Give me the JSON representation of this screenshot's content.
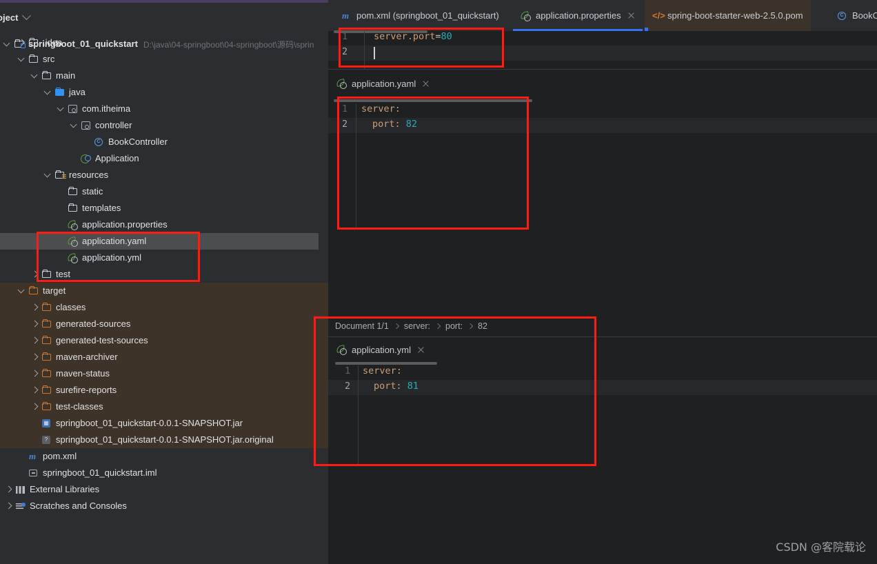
{
  "sidebar": {
    "panel_title": "roject",
    "chevron_icon": "chevron-down-icon",
    "project_name": "springboot_01_quickstart",
    "project_path": "D:\\java\\04-springboot\\04-springboot\\源码\\sprin",
    "items": [
      {
        "label": ".idea",
        "indent": 1,
        "icon": "folder-icon",
        "arrow": "right"
      },
      {
        "label": "src",
        "indent": 1,
        "icon": "folder-icon",
        "arrow": "down"
      },
      {
        "label": "main",
        "indent": 2,
        "icon": "folder-icon",
        "arrow": "down"
      },
      {
        "label": "java",
        "indent": 3,
        "icon": "source-folder-icon",
        "arrow": "down"
      },
      {
        "label": "com.itheima",
        "indent": 4,
        "icon": "package-icon",
        "arrow": "down"
      },
      {
        "label": "controller",
        "indent": 5,
        "icon": "package-icon",
        "arrow": "down"
      },
      {
        "label": "BookController",
        "indent": 6,
        "icon": "class-icon",
        "arrow": "none"
      },
      {
        "label": "Application",
        "indent": 5,
        "icon": "spring-app-icon",
        "arrow": "none"
      },
      {
        "label": "resources",
        "indent": 3,
        "icon": "resource-folder-icon",
        "arrow": "down"
      },
      {
        "label": "static",
        "indent": 4,
        "icon": "folder-icon",
        "arrow": "none"
      },
      {
        "label": "templates",
        "indent": 4,
        "icon": "folder-icon",
        "arrow": "none"
      },
      {
        "label": "application.properties",
        "indent": 4,
        "icon": "spring-config-icon",
        "arrow": "none"
      },
      {
        "label": "application.yaml",
        "indent": 4,
        "icon": "spring-config-icon",
        "arrow": "none",
        "selected": true
      },
      {
        "label": "application.yml",
        "indent": 4,
        "icon": "spring-config-icon",
        "arrow": "none"
      },
      {
        "label": "test",
        "indent": 2,
        "icon": "folder-icon",
        "arrow": "right"
      },
      {
        "label": "target",
        "indent": 1,
        "icon": "folder-orange-icon",
        "arrow": "down",
        "excluded": true
      },
      {
        "label": "classes",
        "indent": 2,
        "icon": "folder-orange-icon",
        "arrow": "right",
        "excluded": true
      },
      {
        "label": "generated-sources",
        "indent": 2,
        "icon": "folder-orange-icon",
        "arrow": "right",
        "excluded": true
      },
      {
        "label": "generated-test-sources",
        "indent": 2,
        "icon": "folder-orange-icon",
        "arrow": "right",
        "excluded": true
      },
      {
        "label": "maven-archiver",
        "indent": 2,
        "icon": "folder-orange-icon",
        "arrow": "right",
        "excluded": true
      },
      {
        "label": "maven-status",
        "indent": 2,
        "icon": "folder-orange-icon",
        "arrow": "right",
        "excluded": true
      },
      {
        "label": "surefire-reports",
        "indent": 2,
        "icon": "folder-orange-icon",
        "arrow": "right",
        "excluded": true
      },
      {
        "label": "test-classes",
        "indent": 2,
        "icon": "folder-orange-icon",
        "arrow": "right",
        "excluded": true
      },
      {
        "label": "springboot_01_quickstart-0.0.1-SNAPSHOT.jar",
        "indent": 2,
        "icon": "jar-icon",
        "arrow": "none",
        "excluded": true
      },
      {
        "label": "springboot_01_quickstart-0.0.1-SNAPSHOT.jar.original",
        "indent": 2,
        "icon": "unknown-file-icon",
        "arrow": "none",
        "excluded": true
      },
      {
        "label": "pom.xml",
        "indent": 1,
        "icon": "maven-icon",
        "arrow": "none"
      },
      {
        "label": "springboot_01_quickstart.iml",
        "indent": 1,
        "icon": "module-icon",
        "arrow": "none"
      },
      {
        "label": "External Libraries",
        "indent": 0,
        "icon": "external-libraries-icon",
        "arrow": "right"
      },
      {
        "label": "Scratches and Consoles",
        "indent": 0,
        "icon": "scratches-icon",
        "arrow": "right"
      }
    ]
  },
  "editor": {
    "tabs": [
      {
        "label": "pom.xml (springboot_01_quickstart)",
        "icon": "maven-icon",
        "closable": false,
        "active": false
      },
      {
        "label": "application.properties",
        "icon": "spring-config-icon",
        "closable": true,
        "active": true
      },
      {
        "label": "spring-boot-starter-web-2.5.0.pom",
        "icon": "xml-icon",
        "closable": false,
        "active": false,
        "readonly": true
      },
      {
        "label": "BookC",
        "icon": "class-icon",
        "closable": false,
        "active": false
      }
    ],
    "properties_editor": {
      "lines": [
        {
          "num": "1",
          "key": "server.port",
          "eq": "=",
          "value": "80"
        },
        {
          "num": "2",
          "key": "",
          "eq": "",
          "value": ""
        }
      ]
    },
    "yaml_editor": {
      "tab_label": "application.yaml",
      "tab_icon": "spring-config-icon",
      "close_icon": "close-icon",
      "lines": [
        {
          "num": "1",
          "key": "server:",
          "value": ""
        },
        {
          "num": "2",
          "key": "port:",
          "value": "82"
        }
      ]
    },
    "yml_panel": {
      "breadcrumb": [
        "Document 1/1",
        "server:",
        "port:",
        "82"
      ],
      "tab_label": "application.yml",
      "tab_icon": "spring-config-icon",
      "close_icon": "close-icon",
      "lines": [
        {
          "num": "1",
          "key": "server:",
          "value": ""
        },
        {
          "num": "2",
          "key": "port:",
          "value": "81"
        }
      ]
    }
  },
  "watermark": "CSDN @客院载论",
  "colors": {
    "accent_blue": "#3574F0",
    "annotation_red": "#FF1A12",
    "excluded_brown": "#3E3328",
    "selection_gray": "#4B4D4F",
    "editor_bg": "#1E2022",
    "panel_bg": "#2B2D30"
  }
}
